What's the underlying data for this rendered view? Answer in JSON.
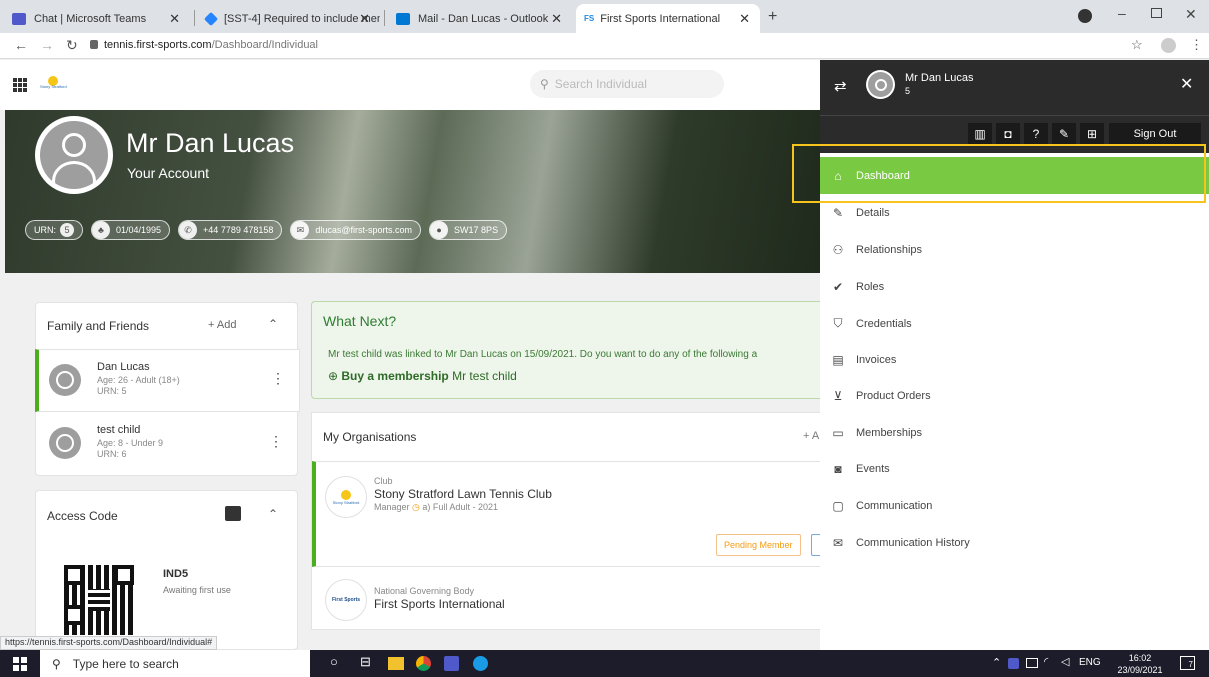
{
  "browser": {
    "tabs": [
      {
        "title": "Chat | Microsoft Teams",
        "color": "#5059c9"
      },
      {
        "title": "[SST-4] Required to include mem",
        "color": "#2684ff"
      },
      {
        "title": "Mail - Dan Lucas - Outlook",
        "color": "#0078d4"
      },
      {
        "title": "First Sports International",
        "color": "#1e88e5"
      }
    ],
    "new_tab": "+",
    "url_host": "tennis.first-sports.com",
    "url_path": "/Dashboard/Individual",
    "status_url": "https://tennis.first-sports.com/Dashboard/Individual#"
  },
  "app": {
    "search_placeholder": "Search Individual",
    "logo_text": "Stony Stratford"
  },
  "profile": {
    "name": "Mr Dan Lucas",
    "subtitle": "Your Account",
    "urn_label": "URN:",
    "urn": "5",
    "dob": "01/04/1995",
    "phone": "+44 7789 478158",
    "email": "dlucas@first-sports.com",
    "postcode": "SW17 8PS"
  },
  "family": {
    "title": "Family and Friends",
    "add": "+ Add",
    "members": [
      {
        "name": "Dan Lucas",
        "age": "Age: 26 - Adult (18+)",
        "urn": "URN: 5"
      },
      {
        "name": "test child",
        "age": "Age: 8 - Under 9",
        "urn": "URN: 6"
      }
    ]
  },
  "access": {
    "title": "Access Code",
    "code": "IND5",
    "status": "Awaiting first use"
  },
  "whatnext": {
    "title": "What Next?",
    "text": "Mr test child was linked to Mr Dan Lucas on 15/09/2021. Do you want to do any of the following a",
    "action_bold": "Buy a membership",
    "action_rest": "Mr test child"
  },
  "orgs": {
    "title": "My Organisations",
    "add": "+ A",
    "items": [
      {
        "type": "Club",
        "name": "Stony Stratford Lawn Tennis Club",
        "role": "Manager",
        "membership": "a) Full Adult - 2021",
        "status": "Pending Member",
        "logo": "Stony Stratford"
      },
      {
        "type": "National Governing Body",
        "name": "First Sports International",
        "logo": "First Sports"
      }
    ]
  },
  "menu": {
    "user_name": "Mr Dan Lucas",
    "user_id": "5",
    "sign_out": "Sign Out",
    "items": [
      {
        "label": "Dashboard",
        "icon": "home-icon"
      },
      {
        "label": "Details",
        "icon": "person-edit-icon"
      },
      {
        "label": "Relationships",
        "icon": "people-icon"
      },
      {
        "label": "Roles",
        "icon": "person-check-icon"
      },
      {
        "label": "Credentials",
        "icon": "shield-icon"
      },
      {
        "label": "Invoices",
        "icon": "document-icon"
      },
      {
        "label": "Product Orders",
        "icon": "cart-icon"
      },
      {
        "label": "Memberships",
        "icon": "monitor-icon"
      },
      {
        "label": "Events",
        "icon": "ticket-icon"
      },
      {
        "label": "Communication",
        "icon": "message-icon"
      },
      {
        "label": "Communication History",
        "icon": "envelope-icon"
      }
    ],
    "active_index": 0,
    "highlight_color": "#f7c31d",
    "active_color": "#7ac943"
  },
  "taskbar": {
    "search": "Type here to search",
    "lang": "ENG",
    "time": "16:02",
    "date": "23/09/2021",
    "notif": "7"
  }
}
